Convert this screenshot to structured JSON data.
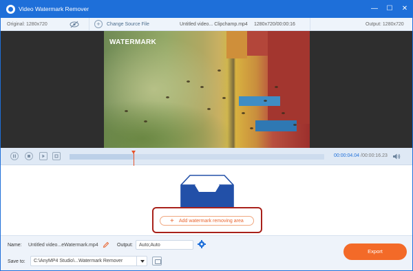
{
  "app": {
    "title": "Video Watermark Remover"
  },
  "window_controls": {
    "minimize": "—",
    "maximize": "☐",
    "close": "✕"
  },
  "infobar": {
    "original": "Original: 1280x720",
    "change_source": "Change Source File",
    "file_name": "Untitled video... Clipchamp.mp4",
    "file_meta": "1280x720/00:00:16",
    "output": "Output: 1280x720"
  },
  "preview": {
    "watermark_text": "WATERMARK"
  },
  "timeline": {
    "current_time": "00:00:04.04",
    "total_time": "/00:00:16.23",
    "progress": 0.25
  },
  "work_area": {
    "add_area_label": "Add watermark removing area"
  },
  "footer": {
    "name_label": "Name:",
    "name_value": "Untitled video...eWatermark.mp4",
    "output_label": "Output:",
    "output_value": "Auto;Auto",
    "save_label": "Save to:",
    "save_value": "C:\\AnyMP4 Studio\\...Watermark Remover",
    "export_label": "Export"
  },
  "colors": {
    "title_bar": "#1e6fd9",
    "accent_orange": "#f36a28",
    "highlight_red": "#a8201a",
    "tray_blue": "#2250a8"
  }
}
